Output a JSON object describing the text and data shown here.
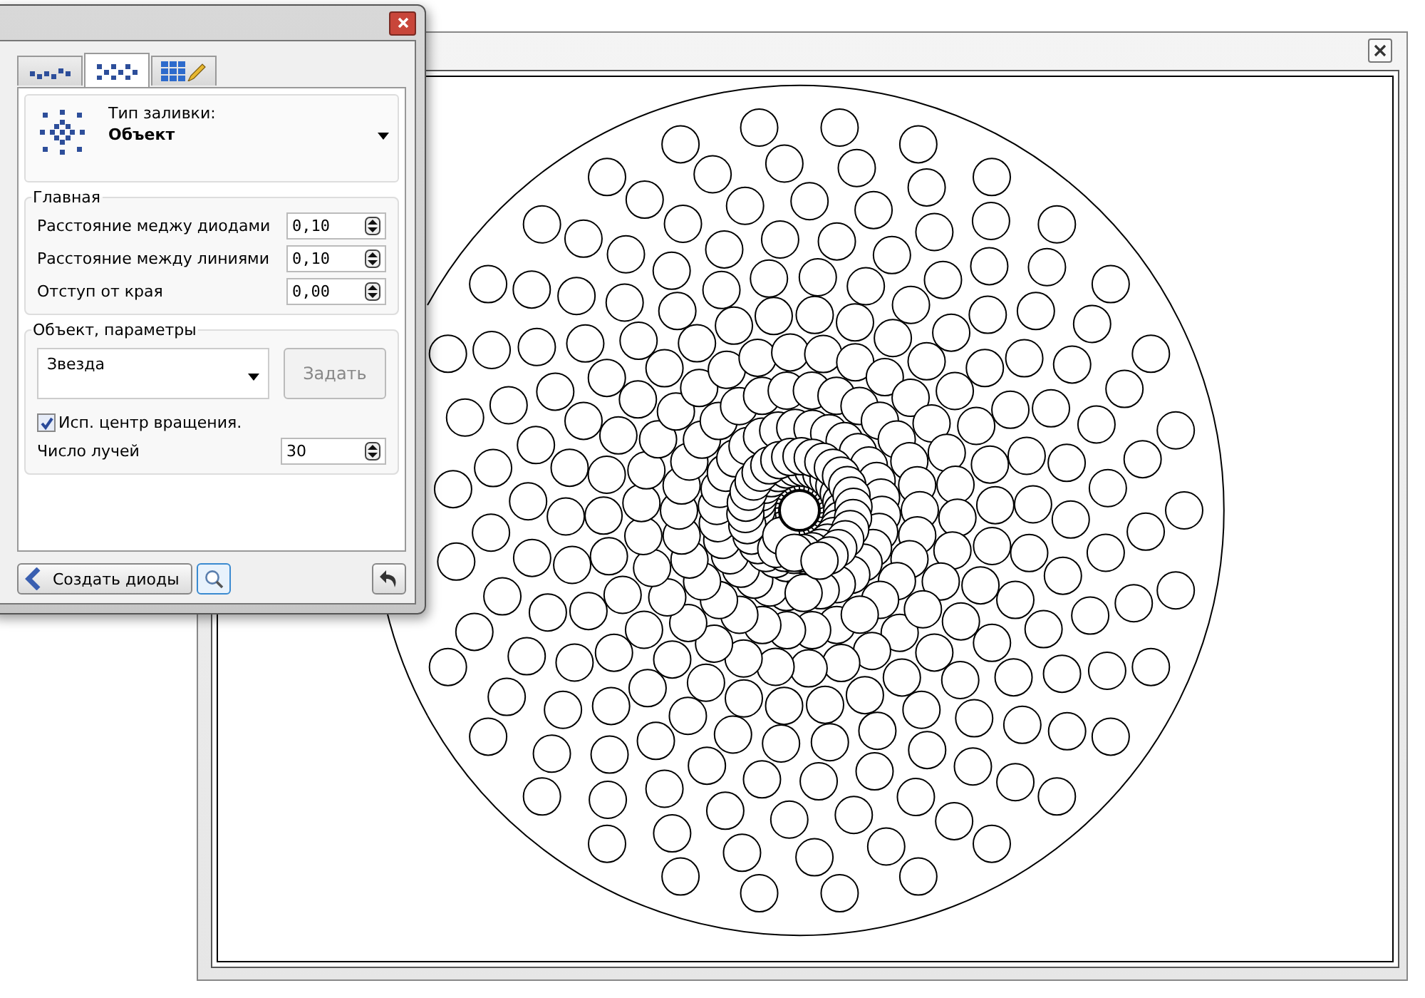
{
  "tool_panel": {
    "tabs": [
      {
        "kind": "dots",
        "selected": false
      },
      {
        "kind": "cross",
        "selected": true
      },
      {
        "kind": "grid",
        "selected": false
      }
    ],
    "fill_type": {
      "label": "Тип заливки:",
      "value": "Объект"
    },
    "main_group": {
      "title": "Главная",
      "fields": [
        {
          "label": "Расстояние меджу диодами",
          "value": "0,10"
        },
        {
          "label": "Расстояние между линиями",
          "value": "0,10"
        },
        {
          "label": "Отступ от края",
          "value": "0,00"
        }
      ]
    },
    "object_group": {
      "title": "Объект, параметры",
      "shape": "Звезда",
      "set_button": {
        "label": "Задать",
        "disabled": true
      },
      "rotation_center": {
        "label": "Исп. центр вращения.",
        "checked": true
      },
      "rays": {
        "label": "Число лучей",
        "value": "30"
      }
    },
    "create_button": "Создать диоды"
  }
}
